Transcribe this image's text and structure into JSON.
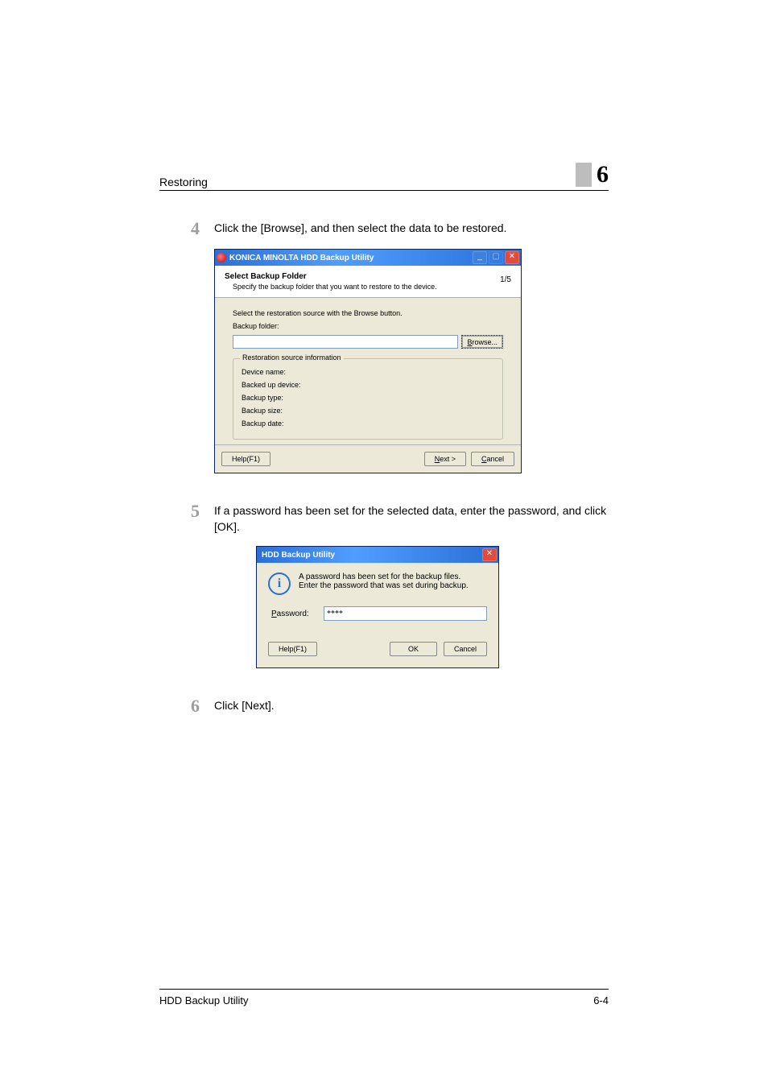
{
  "header": {
    "title": "Restoring",
    "chapter": "6"
  },
  "steps": {
    "s4": {
      "num": "4",
      "text": "Click the [Browse], and then select the data to be restored."
    },
    "s5": {
      "num": "5",
      "text": "If a password has been set for the selected data, enter the password, and click [OK]."
    },
    "s6": {
      "num": "6",
      "text": "Click [Next]."
    }
  },
  "wizard": {
    "title": "KONICA MINOLTA HDD Backup Utility",
    "head_title": "Select Backup Folder",
    "head_sub": "Specify the backup folder that you want to restore to the device.",
    "step_counter": "1/5",
    "instruction": "Select the restoration source with the Browse button.",
    "folder_label": "Backup folder:",
    "folder_value": "",
    "browse": "Browse...",
    "group_title": "Restoration source information",
    "rows": {
      "device": {
        "label": "Device name:",
        "value": ""
      },
      "backed": {
        "label": "Backed up device:",
        "value": ""
      },
      "type": {
        "label": "Backup type:",
        "value": ""
      },
      "size": {
        "label": "Backup size:",
        "value": ""
      },
      "date": {
        "label": "Backup date:",
        "value": ""
      }
    },
    "buttons": {
      "help": "Help(F1)",
      "next": "Next >",
      "cancel": "Cancel"
    }
  },
  "pw": {
    "title": "HDD Backup Utility",
    "msg1": "A password has been set for the backup files.",
    "msg2": "Enter the password that was set during backup.",
    "label": "Password:",
    "value": "****",
    "buttons": {
      "help": "Help(F1)",
      "ok": "OK",
      "cancel": "Cancel"
    }
  },
  "footer": {
    "left": "HDD Backup Utility",
    "right": "6-4"
  }
}
